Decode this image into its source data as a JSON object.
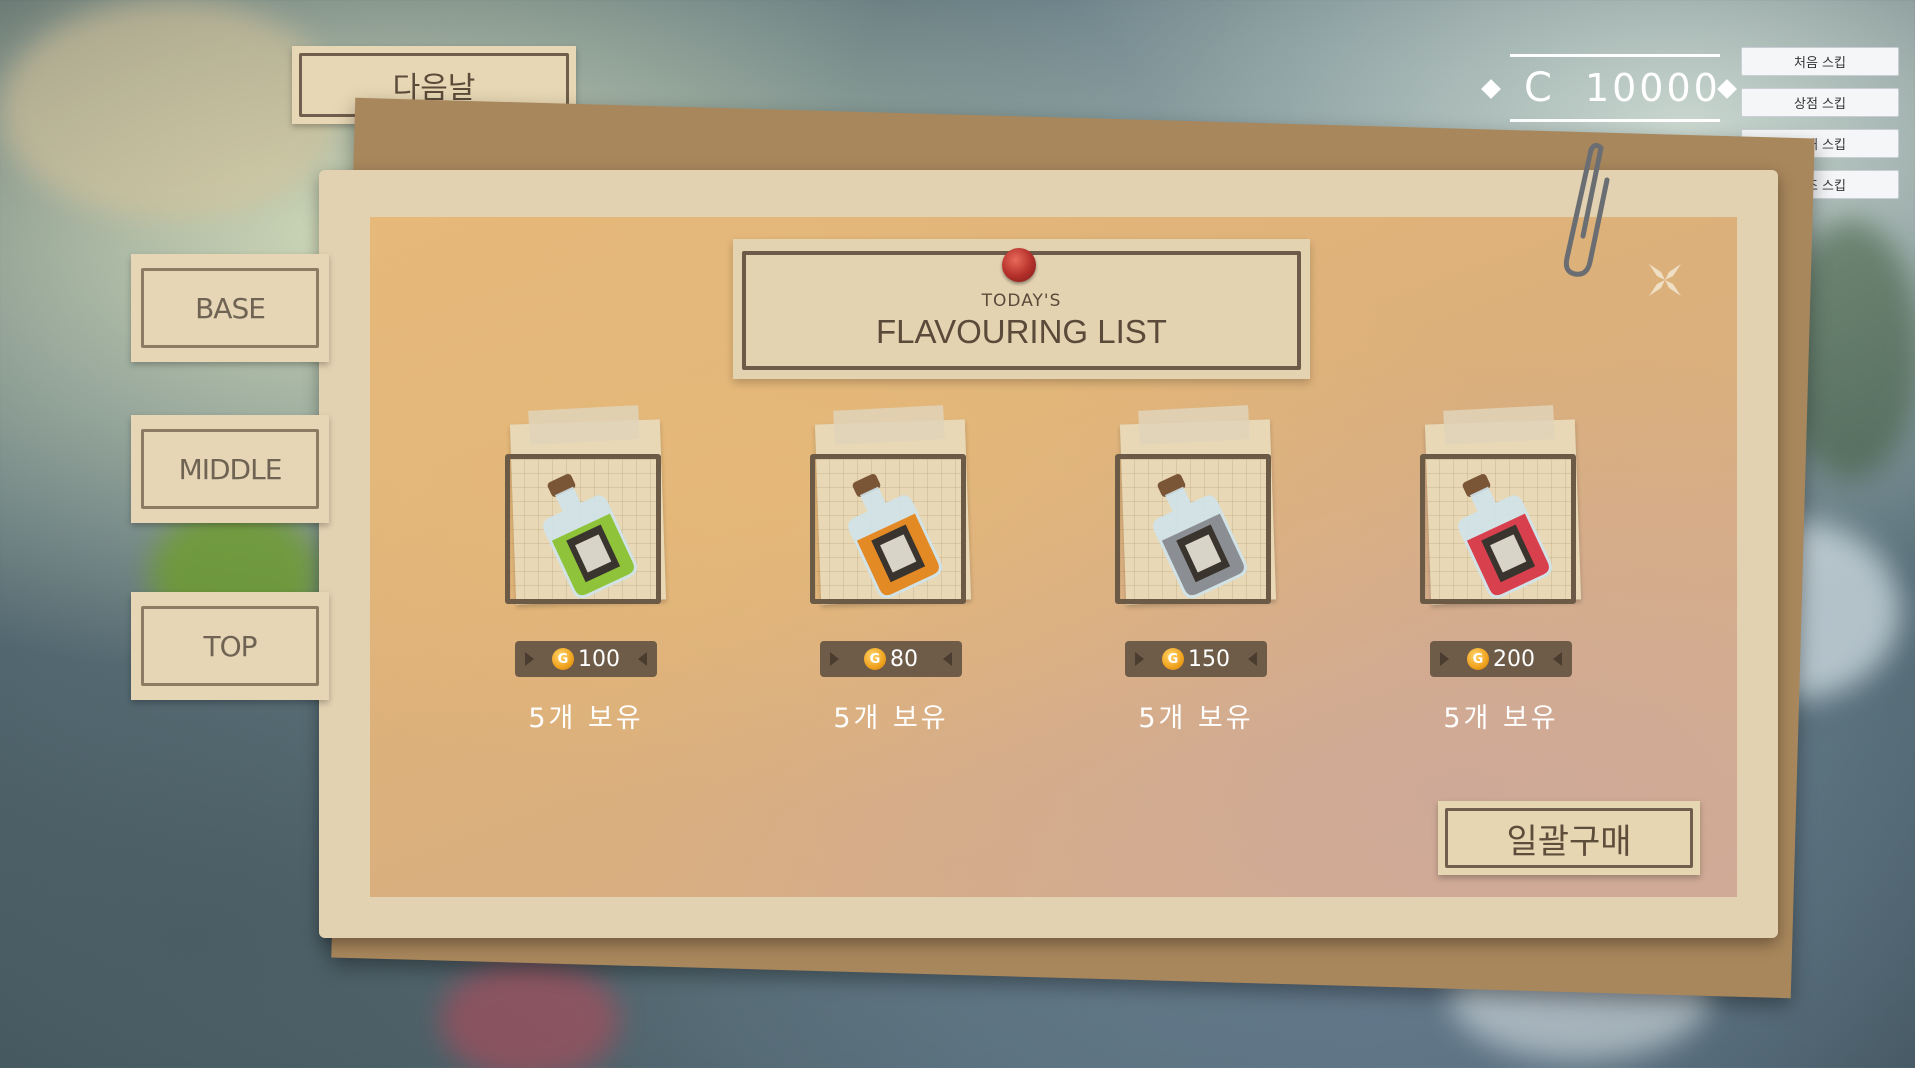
{
  "top_bar": {
    "next_day_label": "다음날",
    "currency_symbol": "C",
    "currency_value": "10000"
  },
  "skip_buttons": [
    {
      "label": "처음 스킵"
    },
    {
      "label": "상점 스킵"
    },
    {
      "label": "구매 스킵"
    },
    {
      "label": "제조 스킵"
    }
  ],
  "tabs": [
    {
      "label": "BASE"
    },
    {
      "label": "MIDDLE"
    },
    {
      "label": "TOP"
    }
  ],
  "title": {
    "sub": "TODAY'S",
    "main": "FLAVOURING LIST"
  },
  "items": [
    {
      "icon": "green-potion-icon",
      "liquid_color": "#8fc33a",
      "price": "100",
      "owned": "5개 보유"
    },
    {
      "icon": "orange-potion-icon",
      "liquid_color": "#e38a25",
      "price": "80",
      "owned": "5개 보유"
    },
    {
      "icon": "gray-potion-icon",
      "liquid_color": "#8b8f93",
      "price": "150",
      "owned": "5개 보유"
    },
    {
      "icon": "red-potion-icon",
      "liquid_color": "#d9404e",
      "price": "200",
      "owned": "5개 보유"
    }
  ],
  "coin_symbol": "G",
  "buy_all_label": "일괄구매",
  "colors": {
    "accent_brown": "#6b5a46",
    "paper": "#e3d2b2"
  }
}
